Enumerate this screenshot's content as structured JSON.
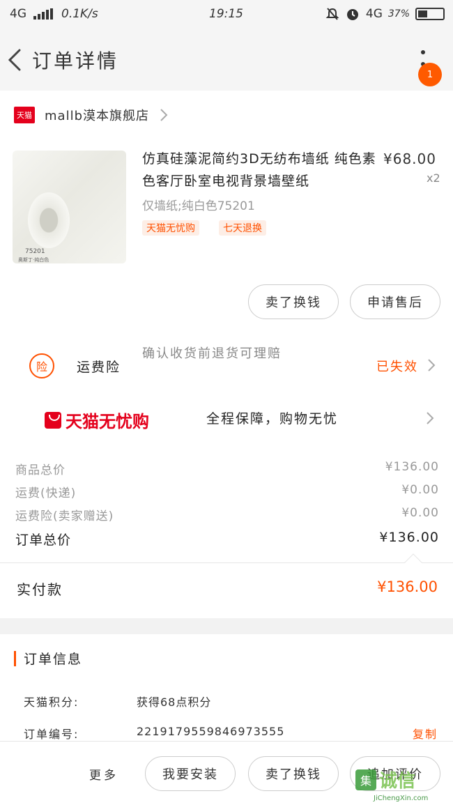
{
  "status_bar": {
    "network": "4G",
    "speed": "0.1K/s",
    "time": "19:15",
    "network_right": "4G",
    "battery": "37%",
    "battery_level": 0.37
  },
  "nav": {
    "title": "订单详情",
    "badge": "1"
  },
  "store": {
    "logo_text": "天猫",
    "name": "mallb漠本旗舰店"
  },
  "product": {
    "title": "仿真硅藻泥简约3D无纺布墙纸 纯色素色客厅卧室电视背景墙壁纸",
    "price": "¥68.00",
    "qty": "x2",
    "sku": "仅墙纸;纯白色75201",
    "tags": [
      "天猫无忧购",
      "七天退换"
    ],
    "thumb_code": "75201",
    "thumb_sub": "奥斯丁·纯白色"
  },
  "actions": {
    "sell_exchange": "卖了换钱",
    "after_sale": "申请售后"
  },
  "insurance": {
    "icon": "险",
    "title": "运费险",
    "desc": "确认收货前退货可理赔",
    "status": "已失效"
  },
  "worry_free": {
    "brand": "天猫无忧购",
    "slogan": "全程保障，购物无忧"
  },
  "prices": [
    {
      "label": "商品总价",
      "value": "¥136.00"
    },
    {
      "label": "运费(快递)",
      "value": "¥0.00"
    },
    {
      "label": "运费险(卖家赠送)",
      "value": "¥0.00"
    }
  ],
  "order_total": {
    "label": "订单总价",
    "value": "¥136.00"
  },
  "paid": {
    "label": "实付款",
    "value": "¥136.00"
  },
  "order_info": {
    "title": "订单信息",
    "points_label": "天猫积分:",
    "points_value": "获得68点积分",
    "number_label": "订单编号:",
    "number_value": "2219179559846973555",
    "copy": "复制"
  },
  "bottom": {
    "more": "更多",
    "install": "我要安装",
    "sell_exchange": "卖了换钱",
    "review": "追加评价"
  },
  "watermark": {
    "text": "诚信",
    "mark": "集",
    "url": "JiChengXin.com"
  },
  "colors": {
    "accent": "#ff5000",
    "tmall_red": "#e4001c"
  }
}
